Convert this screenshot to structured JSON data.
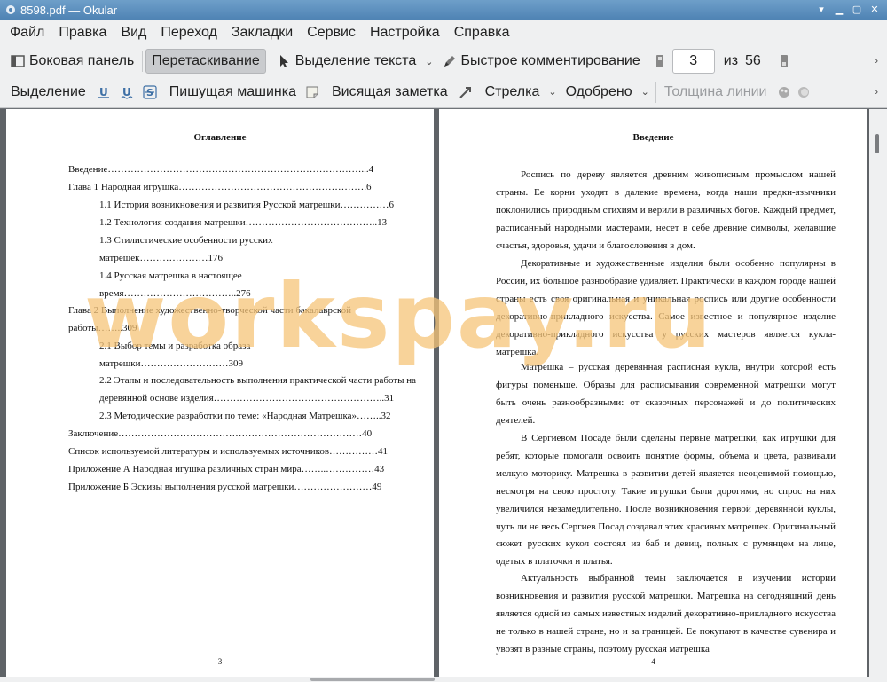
{
  "window": {
    "title": "8598.pdf  — Okular",
    "controls": [
      "▾",
      "▁",
      "▢",
      "✕"
    ]
  },
  "menubar": {
    "items": [
      "Файл",
      "Правка",
      "Вид",
      "Переход",
      "Закладки",
      "Сервис",
      "Настройка",
      "Справка"
    ]
  },
  "toolbar1": {
    "sidebar": "Боковая панель",
    "drag": "Перетаскивание",
    "text_select": "Выделение текста",
    "quick_annotate": "Быстрое комментирование",
    "current_page": "3",
    "of_label": "из",
    "total_pages": "56"
  },
  "toolbar2": {
    "selection": "Выделение",
    "typewriter": "Пишущая машинка",
    "pop_note": "Висящая заметка",
    "arrow": "Стрелка",
    "approved": "Одобрено",
    "line_width": "Толщина линии"
  },
  "left_page": {
    "title": "Оглавление",
    "toc": [
      {
        "text": "Введение……………………………………………………………………...4"
      },
      {
        "text": "Глава 1 Народная игрушка………………………………………………….6"
      },
      {
        "text": "1.1 История возникновения и развития Русской матрешки……………6"
      },
      {
        "text": "1.2 Технология создания матрешки…………………………………..13"
      },
      {
        "text": "1.3 Стилистические особенности русских"
      },
      {
        "text": "матрешек…………………176"
      },
      {
        "text": "1.4 Русская матрешка в настоящее"
      },
      {
        "text": "время……………………………..276"
      },
      {
        "text": "Глава 2 Выполнение художественно-творческой части бакалаврской"
      },
      {
        "text": "работы……..309"
      },
      {
        "text": "2.1 Выбор темы и разработка образа"
      },
      {
        "text": "матрешки………………………309"
      },
      {
        "text": "2.2 Этапы и последовательность выполнения практической части работы на"
      },
      {
        "text": "деревянной основе изделия……………………………………………..31"
      },
      {
        "text": "2.3 Методические разработки по теме: «Народная Матрешка»……..32"
      },
      {
        "text": "Заключение…………………………………………………………………40"
      },
      {
        "text": "Список используемой литературы и используемых источников……………41"
      },
      {
        "text": "Приложение А Народная игушка различных стран мира……..……………43"
      },
      {
        "text": "Приложение Б Эскизы выполнения русской матрешки……………………49"
      }
    ],
    "page_number": "3"
  },
  "right_page": {
    "title": "Введение",
    "paragraphs": [
      "Роспись по дереву является древним живописным промыслом нашей страны. Ее корни уходят в далекие времена, когда наши предки-язычники поклонились природным стихиям и верили в различных богов. Каждый предмет, расписанный народными мастерами, несет в себе древние символы, желавшие счастья, здоровья, удачи и благословения в дом.",
      "Декоративные и художественные изделия были особенно популярны в России, их большое разнообразие удивляет. Практически в каждом городе нашей страны есть своя оригинальная и уникальная роспись или другие особенности декоративно-прикладного искусства. Самое известное и популярное изделие декоративно-прикладного искусства у русских мастеров является кукла-матрешка.",
      "Матрешка – русская деревянная расписная кукла, внутри которой есть фигуры поменьше. Образы для расписывания современной матрешки могут быть очень разнообразными: от сказочных персонажей и до политических деятелей.",
      "В Сергиевом Посаде были сделаны первые матрешки, как игрушки для ребят, которые помогали освоить понятие формы, объема и цвета, развивали мелкую моторику. Матрешка в развитии детей является неоценимой помощью, несмотря на свою простоту. Такие игрушки были дорогими, но спрос на них увеличился незамедлительно. После возникновения первой деревянной куклы, чуть ли не весь Сергиев Посад создавал этих красивых матрешек. Оригинальный сюжет русских кукол состоял из баб и девиц, полных с румянцем на лице, одетых в платочки и платья.",
      "Актуальность выбранной темы заключается в изучении истории возникновения и развития русской матрешки. Матрешка на сегодняшний день является одной из самых известных изделий декоративно-прикладного искусства не только в нашей стране, но и за границей. Ее покупают в качестве сувенира и увозят в разные страны, поэтому русская матрешка"
    ],
    "page_number": "4"
  },
  "watermark": "workspay.ru"
}
